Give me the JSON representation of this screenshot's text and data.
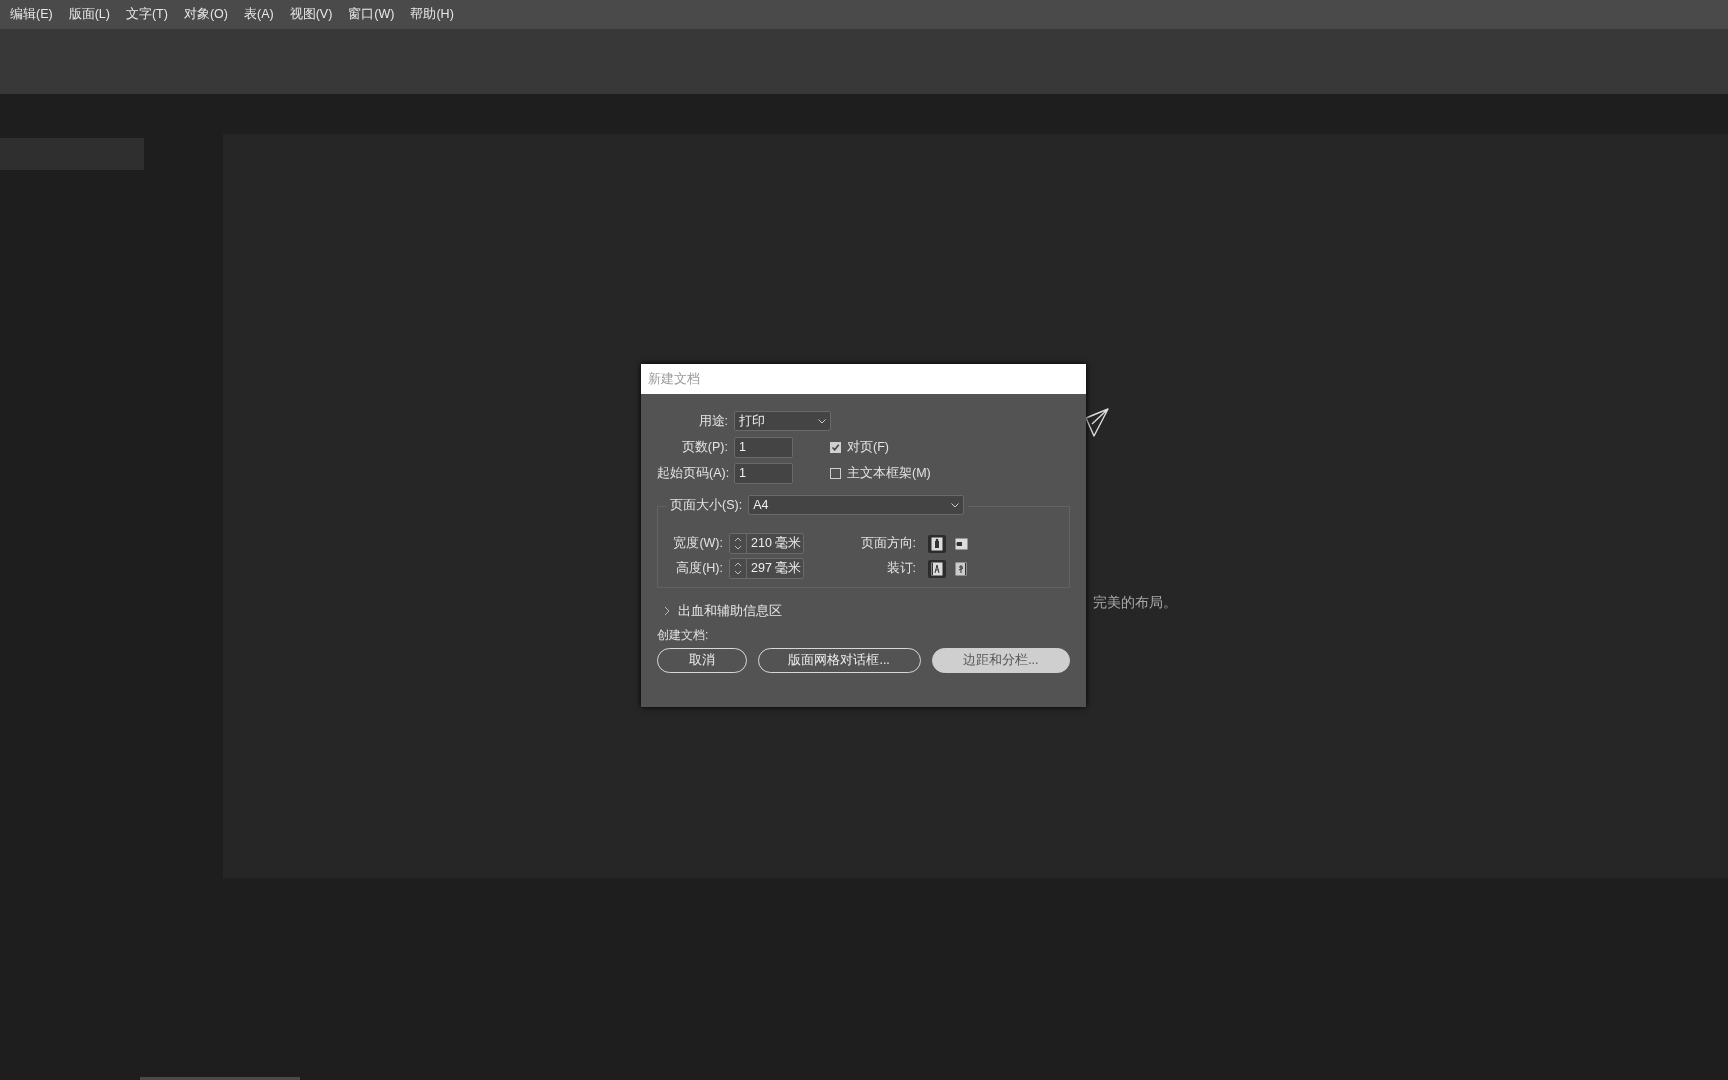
{
  "menu_bar": [
    {
      "label": "编辑(E)"
    },
    {
      "label": "版面(L)"
    },
    {
      "label": "文字(T)"
    },
    {
      "label": "对象(O)"
    },
    {
      "label": "表(A)"
    },
    {
      "label": "视图(V)"
    },
    {
      "label": "窗口(W)"
    },
    {
      "label": "帮助(H)"
    }
  ],
  "start_panel": {
    "message": "完美的布局。"
  },
  "dialog": {
    "title": "新建文档",
    "intent": {
      "label": "用途:",
      "value": "打印"
    },
    "pages": {
      "label": "页数(P):",
      "value": "1"
    },
    "start_page": {
      "label": "起始页码(A):",
      "value": "1"
    },
    "facing_pages": {
      "label": "对页(F)",
      "checked": true
    },
    "primary_text_frame": {
      "label": "主文本框架(M)",
      "checked": false
    },
    "page_size": {
      "label": "页面大小(S):",
      "value": "A4"
    },
    "width": {
      "label": "宽度(W):",
      "value": "210 毫米"
    },
    "height": {
      "label": "高度(H):",
      "value": "297 毫米"
    },
    "orientation": {
      "label": "页面方向:",
      "options": [
        {
          "kind": "portrait",
          "selected": true
        },
        {
          "kind": "landscape",
          "selected": false
        }
      ]
    },
    "binding": {
      "label": "装订:",
      "options": [
        {
          "kind": "left-to-right",
          "selected": true
        },
        {
          "kind": "right-to-left",
          "selected": false
        }
      ]
    },
    "bleed_section": {
      "label": "出血和辅助信息区",
      "expanded": false
    },
    "create_label": "创建文档:",
    "buttons": [
      {
        "label": "取消",
        "kind": "outline"
      },
      {
        "label": "版面网格对话框...",
        "kind": "outline"
      },
      {
        "label": "边距和分栏...",
        "kind": "primary"
      }
    ]
  }
}
